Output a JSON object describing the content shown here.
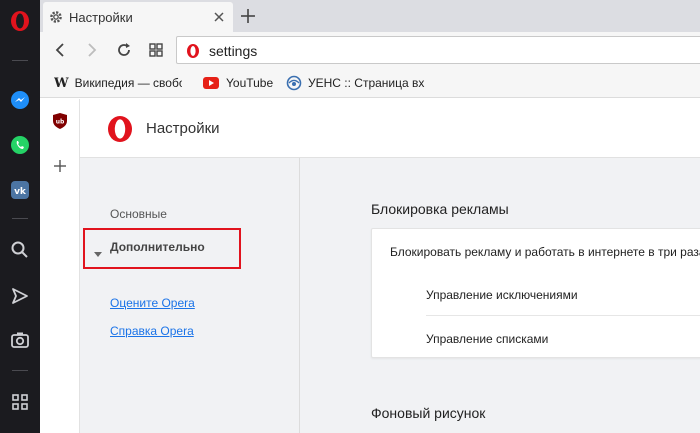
{
  "sidebar": {
    "icons": [
      "opera-logo-icon",
      "messenger-icon",
      "whatsapp-icon",
      "vk-icon",
      "search-icon",
      "send-icon",
      "camera-icon",
      "grid-icon"
    ]
  },
  "tabs": [
    {
      "title": "Настройки",
      "icon": "gear-icon"
    }
  ],
  "address": {
    "url": "settings"
  },
  "bookmarks": [
    {
      "label": "Википедия — свобо",
      "icon": "wikipedia-icon"
    },
    {
      "label": "YouTube",
      "icon": "youtube-icon"
    },
    {
      "label": "УЕНС :: Страница вх",
      "icon": "globe-icon"
    }
  ],
  "settings": {
    "title": "Настройки",
    "nav": {
      "basic": "Основные",
      "advanced": "Дополнительно",
      "rate": "Оцените Opera",
      "help": "Справка Opera"
    },
    "ad_block": {
      "title": "Блокировка рекламы",
      "main": "Блокировать рекламу и работать в интернете в три раза",
      "exceptions": "Управление исключениями",
      "lists": "Управление списками"
    },
    "background": {
      "title": "Фоновый рисунок"
    }
  },
  "colors": {
    "opera_red": "#e1131d",
    "sidebar_bg": "#1b1b1f",
    "highlight": "#e1131d"
  }
}
